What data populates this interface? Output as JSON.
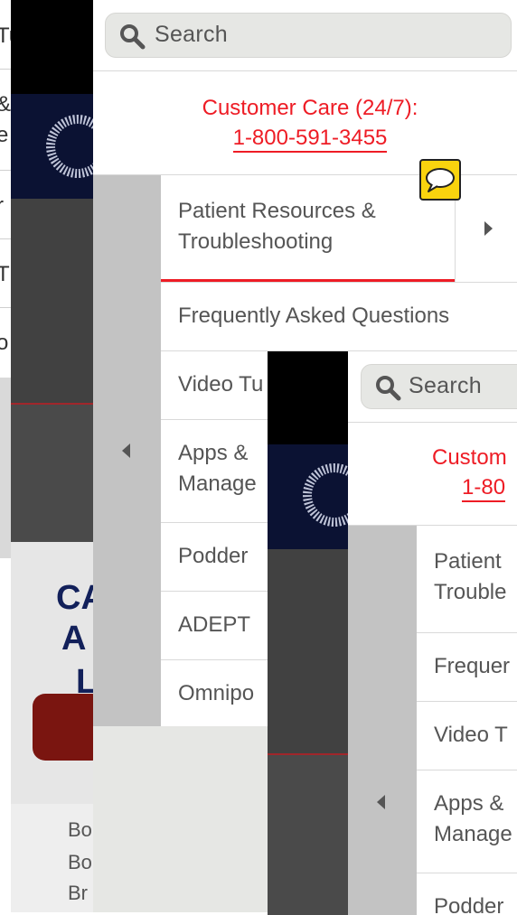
{
  "background_page": {
    "fragments": [
      "Tu",
      "&",
      "e",
      "r",
      "T",
      "o"
    ],
    "hero_title_fragments": [
      "CA",
      "A",
      "L"
    ],
    "link_fragments": [
      "Bo",
      "Bo",
      "Br"
    ]
  },
  "screen1": {
    "search": {
      "placeholder": "Search"
    },
    "customer_care": {
      "title": "Customer Care (24/7):",
      "phone": "1-800-591-3455"
    },
    "menu_items": [
      "Patient Resources & Troubleshooting",
      "Frequently Asked Questions",
      "Video Tu",
      "Apps & Manage",
      "Podder",
      "ADEPT",
      "Omnipo"
    ]
  },
  "screen2": {
    "search": {
      "placeholder": "Search"
    },
    "customer_care": {
      "title": "Custom",
      "phone": "1-80"
    },
    "menu_items": [
      "Patient Trouble",
      "Frequer",
      "Video T",
      "Apps & Manage",
      "Podder"
    ]
  },
  "icons": {
    "search": "search-icon",
    "chat": "chat-bubble-icon",
    "collapse": "triangle-left-icon",
    "expand": "triangle-right-icon"
  },
  "colors": {
    "accent_red": "#ee1c25",
    "navy": "#0b1233",
    "dark_gray": "#414141",
    "rail_gray": "#c3c3c3",
    "chat_yellow": "#f9d30e"
  }
}
